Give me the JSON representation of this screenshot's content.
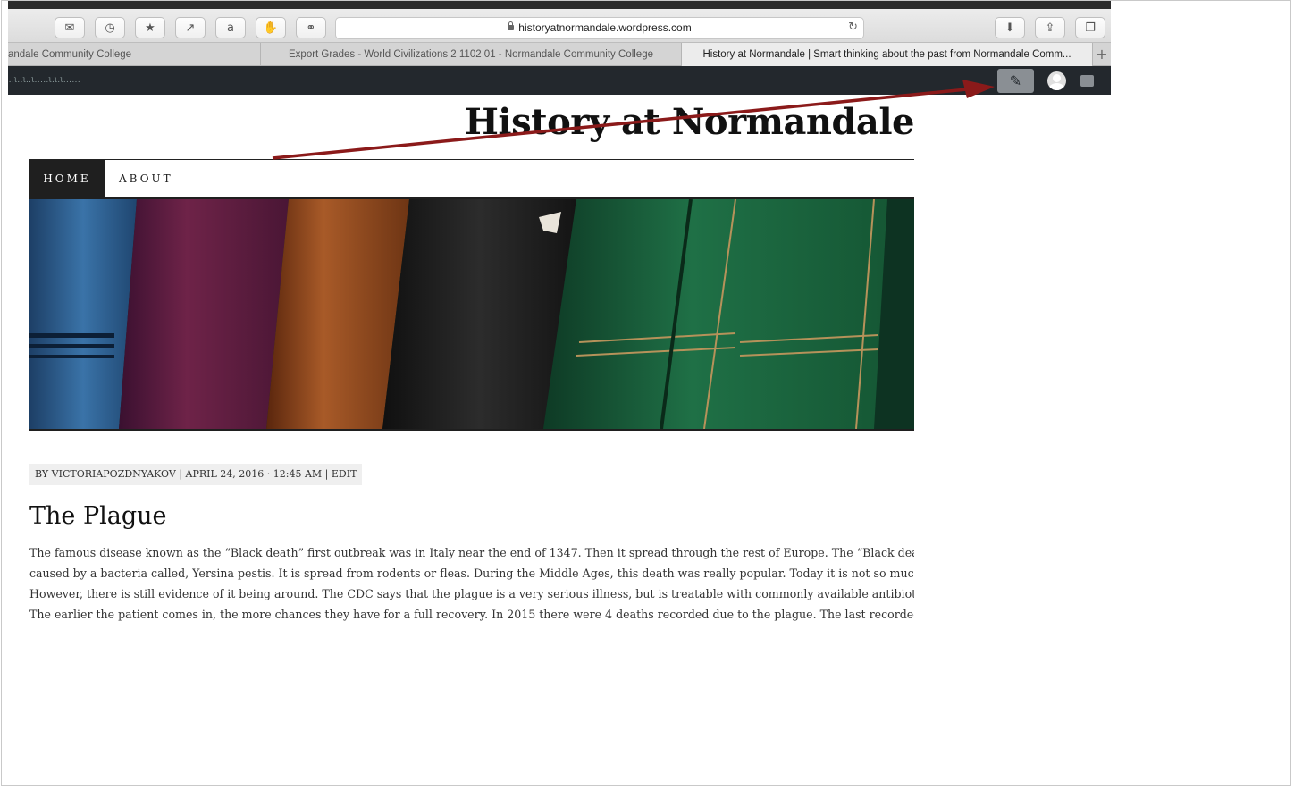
{
  "browser": {
    "url": "historyatnormandale.wordpress.com",
    "toolbar_buttons": [
      "mail-icon",
      "history-icon",
      "bookmark-star-icon",
      "forward-icon",
      "amazon-icon",
      "hand-icon",
      "link-icon"
    ],
    "tabs": [
      {
        "label": "andale Community College"
      },
      {
        "label": "Export Grades - World Civilizations 2 1102 01 - Normandale Community College"
      },
      {
        "label": "History at Normandale | Smart thinking about the past from Normandale Comm..."
      }
    ],
    "new_tab": "+"
  },
  "adminbar": {
    "logo_text": "..l..l..l.....l.l.l......"
  },
  "site": {
    "title": "History at Normandale",
    "nav": [
      "HOME",
      "ABOUT"
    ]
  },
  "post": {
    "meta": "BY VICTORIAPOZDNYAKOV | APRIL 24, 2016 · 12:45 AM | EDIT",
    "title": "The Plague",
    "lines": [
      "The famous disease known as the “Black death” first outbreak was in Italy near the end of 1347. Then it spread through the rest of Europe. The “Black death” is",
      "caused by a bacteria called, Yersina pestis. It is spread from rodents or fleas. During the Middle Ages, this death was really popular. Today it is not so much.",
      "However, there is still evidence of it being around. The CDC says that the plague is a very serious illness, but is treatable with commonly available antibiotics.",
      "The earlier the patient comes in, the more chances they have for a full recovery. In 2015 there were 4 deaths recorded due to the plague. The last recorded death"
    ]
  },
  "colors": {
    "adminbar": "#23282d",
    "annotation_arrow": "#8b1a1a",
    "nav_active": "#1f1f1f"
  }
}
